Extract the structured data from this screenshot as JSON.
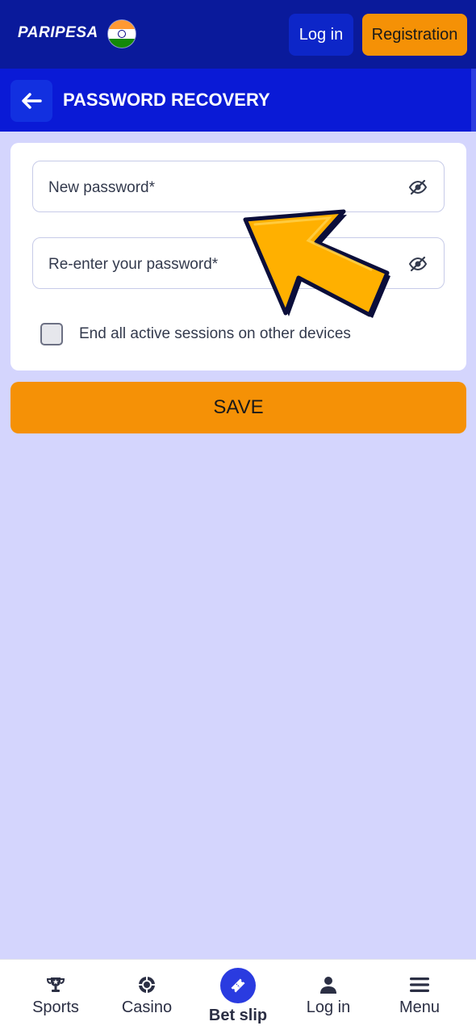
{
  "header": {
    "logo_text": "PARIPESA",
    "login_label": "Log in",
    "registration_label": "Registration"
  },
  "titlebar": {
    "title": "PASSWORD RECOVERY"
  },
  "form": {
    "new_password_placeholder": "New password*",
    "reenter_password_placeholder": "Re-enter your password*",
    "end_sessions_label": "End all active sessions on other devices",
    "end_sessions_checked": false,
    "save_label": "SAVE"
  },
  "bottom_nav": {
    "items": [
      {
        "label": "Sports",
        "icon": "trophy-icon"
      },
      {
        "label": "Casino",
        "icon": "casino-chip-icon"
      },
      {
        "label": "Bet slip",
        "icon": "ticket-icon"
      },
      {
        "label": "Log in",
        "icon": "user-icon"
      },
      {
        "label": "Menu",
        "icon": "menu-icon"
      }
    ]
  },
  "colors": {
    "header_bg": "#0a1a9b",
    "titlebar_bg": "#0a1ad6",
    "accent": "#f59106",
    "page_bg": "#d4d5fd"
  }
}
